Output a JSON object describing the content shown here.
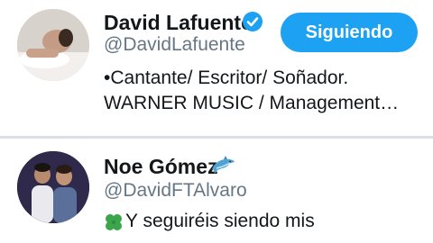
{
  "users": [
    {
      "name": "David Lafuente",
      "handle": "@DavidLafuente",
      "verified": true,
      "bio_lines": [
        "•Cantante/ Escritor/ Soñador.",
        "WARNER MUSIC / Management…"
      ],
      "follow_label": "Siguiendo"
    },
    {
      "name": "Noe Gómez",
      "handle": "@DavidFTAlvaro",
      "name_emoji": "dolphin",
      "bio_emoji": "four-leaf-clover",
      "bio_text": "Y seguiréis siendo mis"
    }
  ],
  "colors": {
    "accent": "#1da1f2",
    "name_text": "#14171a",
    "secondary_text": "#657786",
    "divider": "#d9e0e5"
  }
}
